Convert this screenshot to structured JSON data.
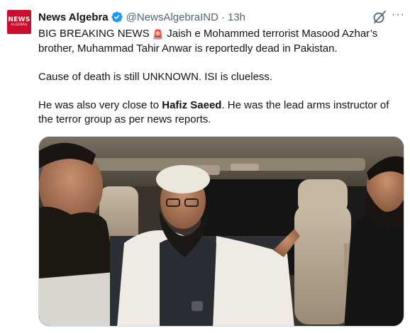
{
  "account": {
    "avatar_text_top": "NEWS",
    "avatar_text_bottom": "ALGEBRA",
    "display_name": "News Algebra",
    "handle": "@NewsAlgebraIND",
    "separator": "·",
    "timestamp": "13h",
    "verified": true,
    "verified_color": "#1d9bf0",
    "brand_color": "#c8102e"
  },
  "icons": {
    "verified": "verified-badge-icon",
    "grok": "grok-icon",
    "more": "more-options-icon",
    "siren": "police-siren-emoji"
  },
  "more_glyph": "···",
  "tweet": {
    "line1_prefix": "BIG BREAKING NEWS ",
    "siren_glyph": "🚨",
    "line1_suffix": " Jaish e Mohammed terrorist Masood Azhar’s brother, Muhammad Tahir Anwar is reportedly dead in Pakistan.",
    "paragraph2": "Cause of death is still UNKNOWN. ISI is clueless.",
    "p3_prefix": "He was also very close to ",
    "p3_bold": "Hafiz Saeed",
    "p3_suffix": ". He was the lead arms instructor of the terror group as per news reports."
  },
  "media": {
    "type": "photo",
    "description_icon": "photo-men-in-vehicle"
  }
}
